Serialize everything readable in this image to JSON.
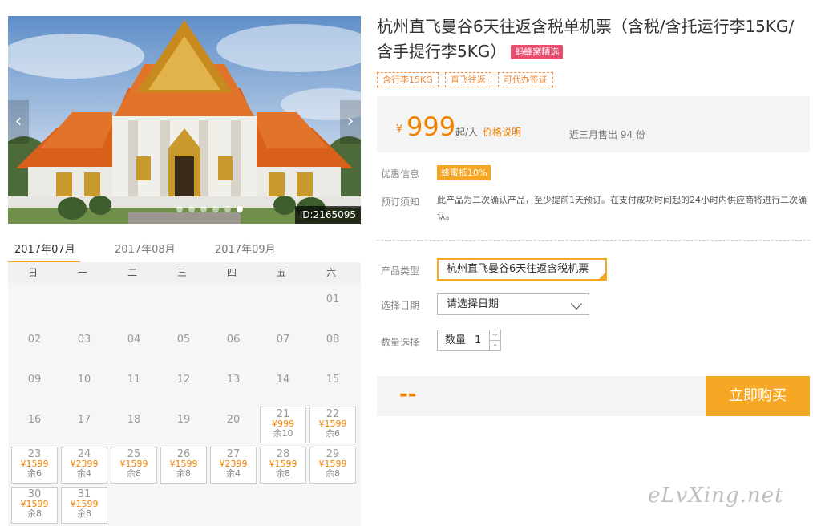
{
  "gallery": {
    "id_label": "ID:2165095",
    "prev_glyph": "‹",
    "next_glyph": "›",
    "slide_count": 6,
    "active_slide": 5,
    "prev_icon": "chevron-left-icon",
    "next_icon": "chevron-right-icon"
  },
  "product": {
    "title": "杭州直飞曼谷6天往返含税单机票（含税/含托运行李15KG/含手提行李5KG）",
    "badge": "蚂蜂窝精选",
    "tags": [
      "含行李15KG",
      "直飞往返",
      "可代办签证"
    ]
  },
  "price": {
    "currency": "¥",
    "amount": "999",
    "unit": "起/人",
    "note_link": "价格说明",
    "sold": "近三月售出 94 份"
  },
  "info": {
    "promo_label": "优惠信息",
    "promo": "蜂蜜抵10%",
    "notice_label": "预订须知",
    "notice": "此产品为二次确认产品，至少提前1天预订。在支付成功时间起的24小时内供应商将进行二次确认。"
  },
  "form": {
    "product_type_label": "产品类型",
    "product_type_value": "杭州直飞曼谷6天往返含税机票",
    "date_label": "选择日期",
    "date_placeholder": "请选择日期",
    "qty_label": "数量选择",
    "qty_prefix": "数量",
    "qty_value": "1",
    "plus": "+",
    "minus": "-"
  },
  "buy": {
    "total": "--",
    "button": "立即购买"
  },
  "calendar": {
    "months": [
      "2017年07月",
      "2017年08月",
      "2017年09月"
    ],
    "active_month": 0,
    "weekdays": [
      "日",
      "一",
      "二",
      "三",
      "四",
      "五",
      "六"
    ],
    "first_weekday": 6,
    "days": [
      {
        "d": "01"
      },
      {
        "d": "02"
      },
      {
        "d": "03"
      },
      {
        "d": "04"
      },
      {
        "d": "05"
      },
      {
        "d": "06"
      },
      {
        "d": "07"
      },
      {
        "d": "08"
      },
      {
        "d": "09"
      },
      {
        "d": "10"
      },
      {
        "d": "11"
      },
      {
        "d": "12"
      },
      {
        "d": "13"
      },
      {
        "d": "14"
      },
      {
        "d": "15"
      },
      {
        "d": "16"
      },
      {
        "d": "17"
      },
      {
        "d": "18"
      },
      {
        "d": "19"
      },
      {
        "d": "20"
      },
      {
        "d": "21",
        "price": "¥999",
        "rest": "余10"
      },
      {
        "d": "22",
        "price": "¥1599",
        "rest": "余6"
      },
      {
        "d": "23",
        "price": "¥1599",
        "rest": "余6"
      },
      {
        "d": "24",
        "price": "¥2399",
        "rest": "余4"
      },
      {
        "d": "25",
        "price": "¥1599",
        "rest": "余8"
      },
      {
        "d": "26",
        "price": "¥1599",
        "rest": "余8"
      },
      {
        "d": "27",
        "price": "¥2399",
        "rest": "余4"
      },
      {
        "d": "28",
        "price": "¥1599",
        "rest": "余8"
      },
      {
        "d": "29",
        "price": "¥1599",
        "rest": "余8"
      },
      {
        "d": "30",
        "price": "¥1599",
        "rest": "余8"
      },
      {
        "d": "31",
        "price": "¥1599",
        "rest": "余8"
      }
    ]
  },
  "watermark": "eLvXing.net",
  "colors": {
    "accent": "#f5a623",
    "price": "#f08200",
    "badge": "#e84d6f"
  }
}
